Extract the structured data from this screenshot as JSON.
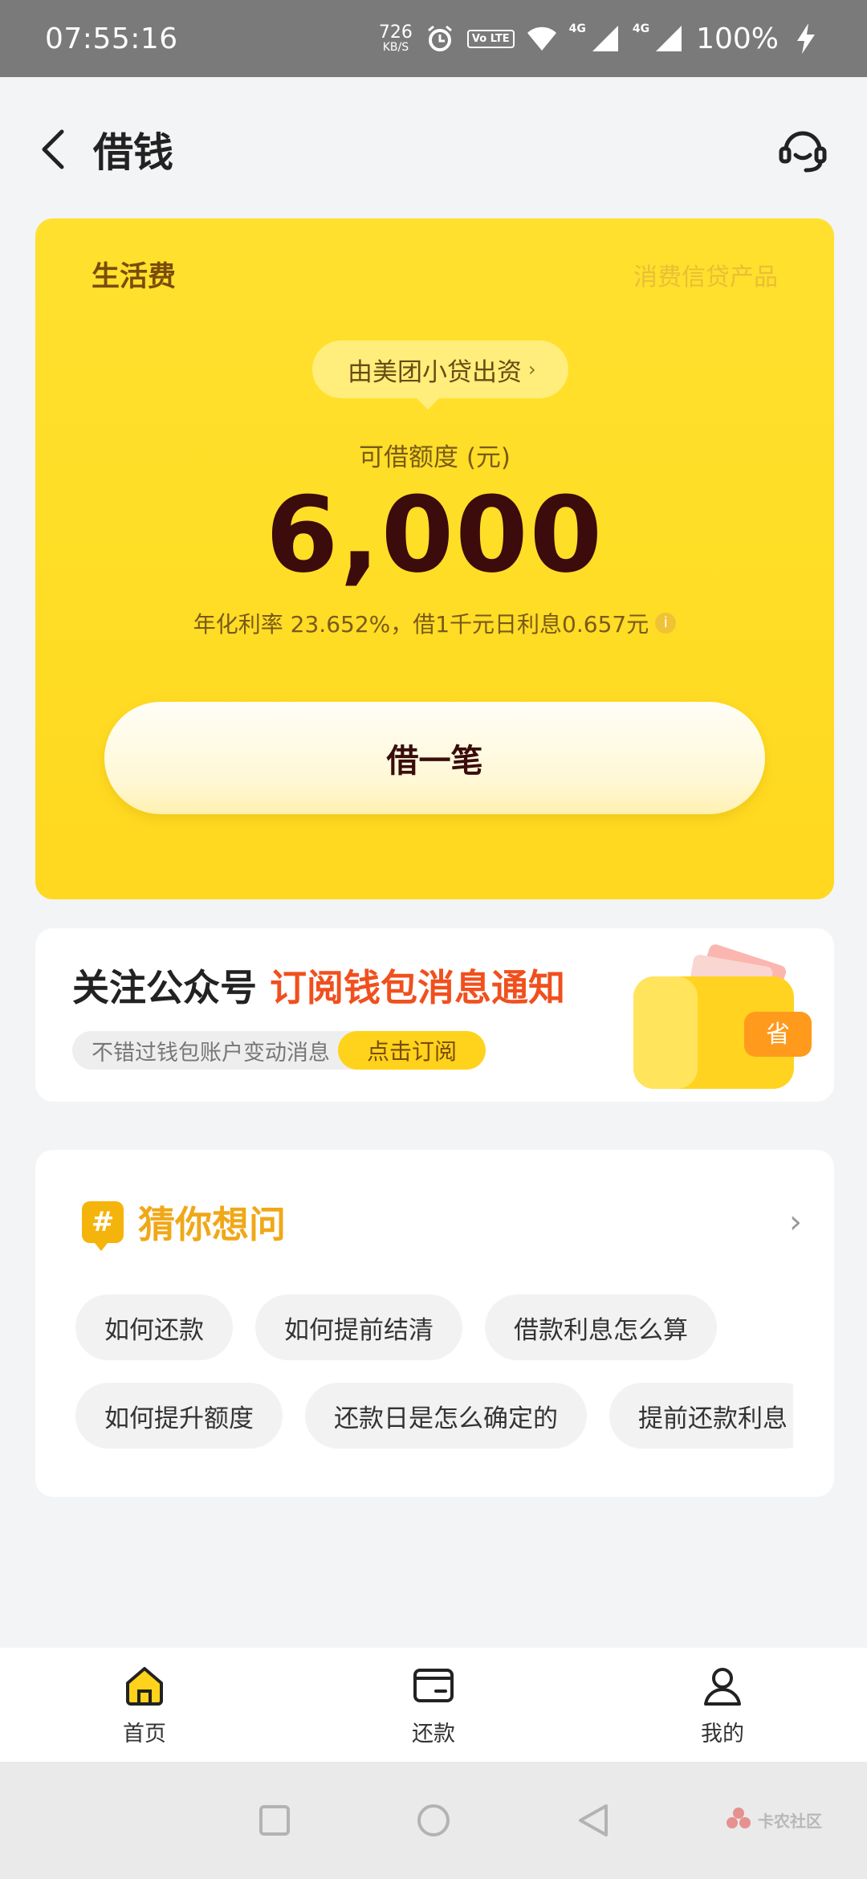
{
  "status_bar": {
    "time": "07:55:16",
    "net_speed": "726",
    "net_speed_unit": "KB/S",
    "volte_label": "Vo LTE",
    "sim1_label": "4G",
    "sim2_label": "4G",
    "battery": "100%"
  },
  "header": {
    "title": "借钱"
  },
  "loan_card": {
    "product": "生活费",
    "product_type": "消费信贷产品",
    "lender": "由美团小贷出资",
    "lender_chevron": "›",
    "quota_label": "可借额度 (元)",
    "quota_amount": "6,000",
    "rate_text": "年化利率 23.652%，借1千元日利息0.657元",
    "info_icon_glyph": "i",
    "borrow_button": "借一笔"
  },
  "subscribe": {
    "title_prefix": "关注公众号 ",
    "title_highlight": "订阅钱包消息通知",
    "description": "不错过钱包账户变动消息",
    "button": "点击订阅",
    "wallet_badge": "省"
  },
  "faq": {
    "badge": "#",
    "title": "猜你想问",
    "more_icon": "›",
    "row1": [
      "如何还款",
      "如何提前结清",
      "借款利息怎么算"
    ],
    "row2": [
      "如何提升额度",
      "还款日是怎么确定的",
      "提前还款利息"
    ]
  },
  "bottom_nav": {
    "items": [
      {
        "label": "首页",
        "icon": "home-icon"
      },
      {
        "label": "还款",
        "icon": "wallet-icon"
      },
      {
        "label": "我的",
        "icon": "profile-icon"
      }
    ]
  },
  "watermark": {
    "text": "卡农社区"
  },
  "colors": {
    "accent_yellow": "#ffd81f",
    "highlight_orange": "#f0501e",
    "amount_dark": "#3c0b0b"
  }
}
